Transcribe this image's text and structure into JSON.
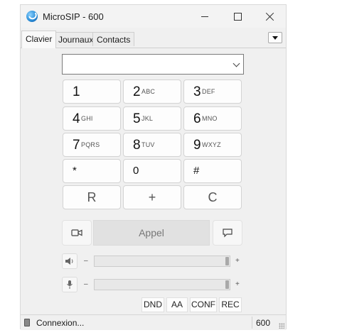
{
  "window": {
    "title": "MicroSIP - 600"
  },
  "tabs": [
    {
      "label": "Clavier",
      "active": true
    },
    {
      "label": "Journaux",
      "active": false
    },
    {
      "label": "Contacts",
      "active": false
    }
  ],
  "dialer": {
    "number_value": "",
    "number_placeholder": ""
  },
  "keypad": [
    {
      "digit": "1",
      "letters": ""
    },
    {
      "digit": "2",
      "letters": "ABC"
    },
    {
      "digit": "3",
      "letters": "DEF"
    },
    {
      "digit": "4",
      "letters": "GHI"
    },
    {
      "digit": "5",
      "letters": "JKL"
    },
    {
      "digit": "6",
      "letters": "MNO"
    },
    {
      "digit": "7",
      "letters": "PQRS"
    },
    {
      "digit": "8",
      "letters": "TUV"
    },
    {
      "digit": "9",
      "letters": "WXYZ"
    },
    {
      "digit": "*",
      "letters": ""
    },
    {
      "digit": "0",
      "letters": ""
    },
    {
      "digit": "#",
      "letters": ""
    }
  ],
  "functions": {
    "redial": "R",
    "plus": "+",
    "clear": "C"
  },
  "actions": {
    "call_label": "Appel",
    "video_icon": "video-camera-icon",
    "message_icon": "chat-bubble-icon"
  },
  "speaker": {
    "icon": "speaker-icon",
    "minus": "–",
    "plus": "+",
    "level": 1.0
  },
  "microphone": {
    "icon": "microphone-icon",
    "minus": "–",
    "plus": "+",
    "level": 1.0
  },
  "toggles": {
    "dnd": "DND",
    "aa": "AA",
    "conf": "CONF",
    "rec": "REC"
  },
  "status": {
    "text": "Connexion...",
    "extension": "600"
  },
  "colors": {
    "window_bg": "#f0f0f0",
    "key_bg": "#fdfdfd",
    "call_bg": "#e1e1e1"
  }
}
